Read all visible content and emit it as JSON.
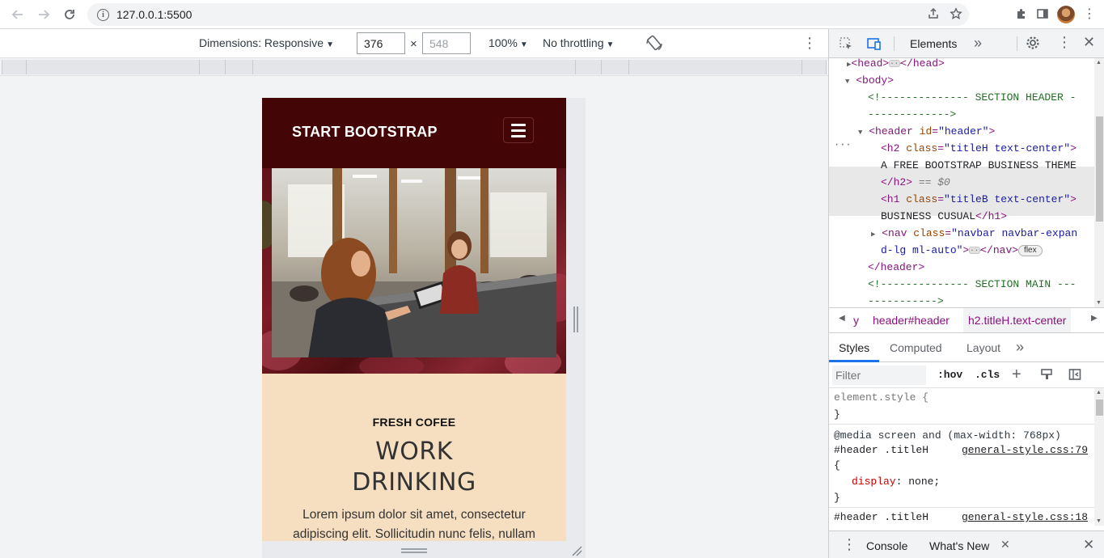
{
  "browser": {
    "url": "127.0.0.1:5500"
  },
  "device_toolbar": {
    "dimensions_label": "Dimensions: Responsive",
    "width": "376",
    "height": "548",
    "times": "×",
    "zoom": "100%",
    "throttling": "No throttling"
  },
  "site": {
    "brand": "START BOOTSTRAP",
    "subtitle": "FRESH COFEE",
    "title_line1": "WORK",
    "title_line2": "DRINKING",
    "lead": "Lorem ipsum dolor sit amet, consectetur adipiscing elit. Sollicitudin nunc felis, nullam"
  },
  "devtools": {
    "tab_elements": "Elements",
    "dom": {
      "l0_open": "<head>",
      "l0_close": "</head>",
      "l1": "<body>",
      "c1a": "<!-------------- SECTION HEADER -",
      "c1b": "------------->",
      "header_tag": "<header",
      "header_attr": "id",
      "header_val": "\"header\"",
      "header_end": ">",
      "h2_open": "<h2",
      "h2_attr": "class",
      "h2_val": "\"titleH text-center\"",
      "h2_end": ">",
      "h2_text": "A FREE BOOTSTRAP BUSINESS THEME",
      "h2_close": "</h2>",
      "h2_eq": "== $0",
      "h1_open": "<h1",
      "h1_attr": "class",
      "h1_val": "\"titleB text-center\"",
      "h1_end": ">",
      "h1_text": "BUSINESS CUSUAL",
      "h1_close": "</h1>",
      "nav_open": "<nav",
      "nav_attr": "class",
      "nav_val_a": "\"navbar navbar-expan",
      "nav_val_b": "d-lg ml-auto\"",
      "nav_end": ">",
      "nav_close": "</nav>",
      "flex_badge": "flex",
      "header_close": "</header>",
      "c2a": "<!-------------- SECTION MAIN ---",
      "c2b": "----------->"
    },
    "breadcrumbs": [
      "y",
      "header#header",
      "h2.titleH.text-center"
    ],
    "sub_tabs": [
      "Styles",
      "Computed",
      "Layout"
    ],
    "filter_placeholder": "Filter",
    "hov": ":hov",
    "cls": ".cls",
    "styles": {
      "element_style": "element.style {",
      "close1": "}",
      "media": "@media screen and (max-width: 768px)",
      "selector1": "#header .titleH",
      "src1": "general-style.css:79",
      "open1": "{",
      "prop1_name": "display",
      "prop1_value": ": none;",
      "close2": "}",
      "selector2": "#header .titleH",
      "src2": "general-style.css:18",
      "open2": "{"
    },
    "drawer": {
      "console": "Console",
      "whats_new": "What's New"
    }
  },
  "colors": {
    "site_nav": "#440507",
    "card_bg": "#f6dfc1",
    "accent": "#1a73e8"
  }
}
